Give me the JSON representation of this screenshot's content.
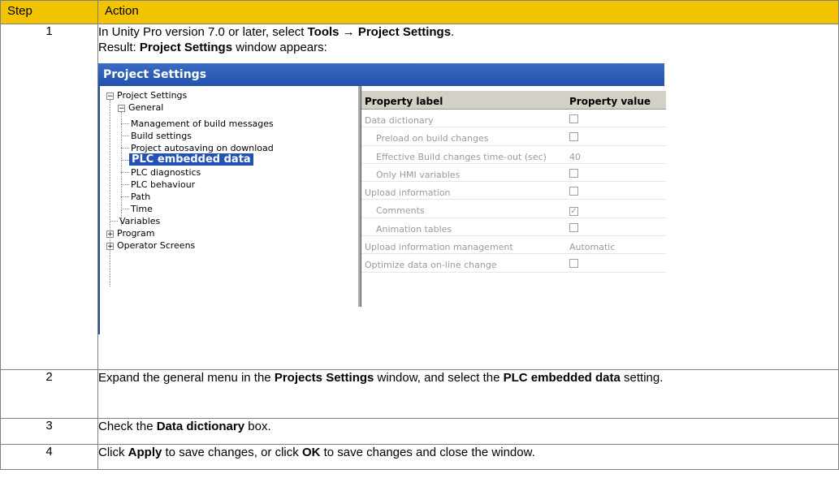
{
  "headers": {
    "step": "Step",
    "action": "Action"
  },
  "rows": [
    {
      "step": "1",
      "line1_a": "In Unity Pro version 7.0 or later, select ",
      "line1_b": "Tools → Project Settings",
      "line1_c": ".",
      "line2_a": "Result: ",
      "line2_b": "Project Settings",
      "line2_c": " window appears:"
    },
    {
      "step": "2",
      "a": "Expand the general menu in the ",
      "b": "Projects Settings",
      "c": " window, and select the ",
      "d": "PLC embedded data",
      "e": " setting."
    },
    {
      "step": "3",
      "a": "Check the ",
      "b": "Data dictionary",
      "c": " box."
    },
    {
      "step": "4",
      "a": "Click ",
      "b": "Apply",
      "c": " to save changes, or click ",
      "d": "OK",
      "e": " to save changes and close the window."
    }
  ],
  "window": {
    "title": "Project Settings",
    "tree": {
      "root": "Project Settings",
      "general": "General",
      "children": [
        "Management of build messages",
        "Build settings",
        "Project autosaving on download",
        "PLC embedded data",
        "PLC diagnostics",
        "PLC behaviour",
        "Path",
        "Time"
      ],
      "variables": "Variables",
      "program": "Program",
      "operator_screens": "Operator Screens"
    },
    "grid": {
      "col_label": "Property label",
      "col_value": "Property value",
      "rows": [
        {
          "label": "Data dictionary",
          "value": ""
        },
        {
          "label": "Preload on build changes",
          "value": ""
        },
        {
          "label": "Effective Build changes time-out (sec)",
          "value": "40"
        },
        {
          "label": "Only HMI variables",
          "value": ""
        },
        {
          "label": "Upload information",
          "value": ""
        },
        {
          "label": "Comments",
          "value": "✓"
        },
        {
          "label": "Animation tables",
          "value": ""
        },
        {
          "label": "Upload information management",
          "value": "Automatic"
        },
        {
          "label": "Optimize data on-line change",
          "value": ""
        }
      ]
    }
  }
}
